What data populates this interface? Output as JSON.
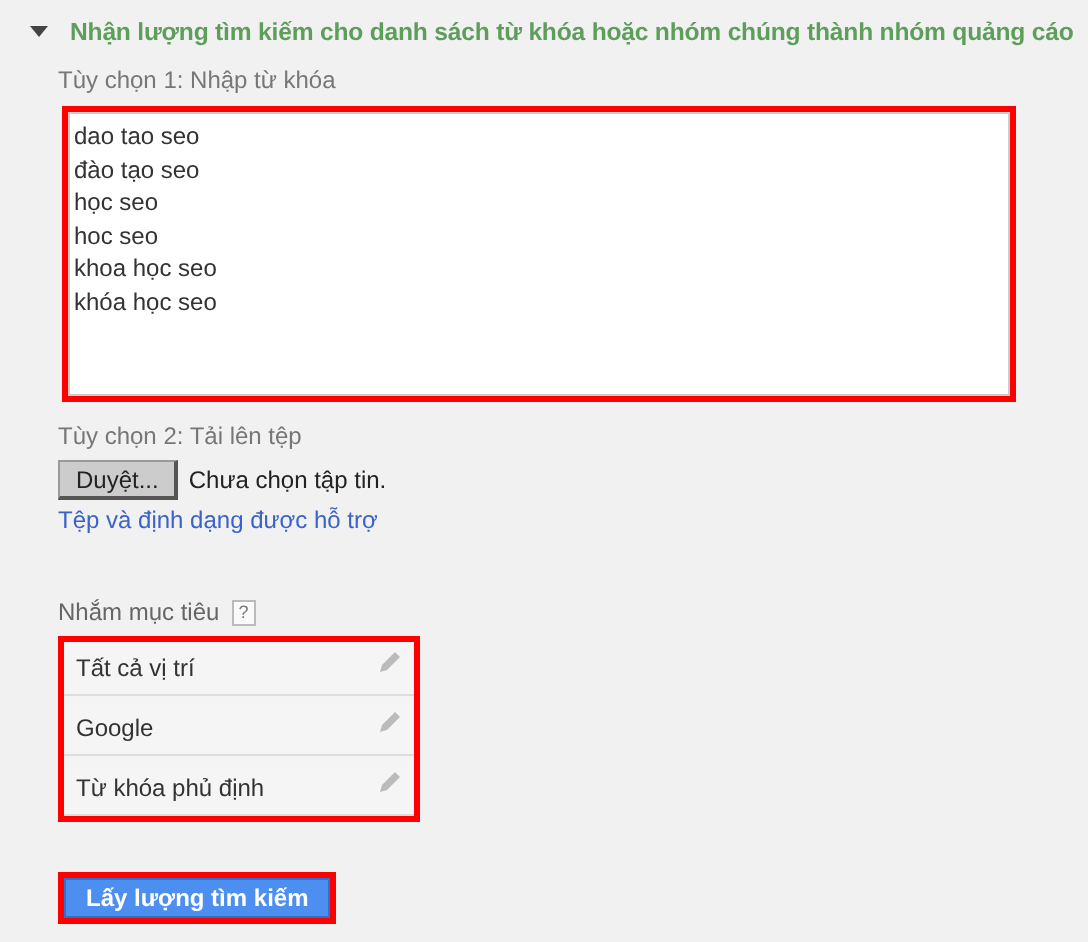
{
  "section": {
    "title": "Nhận lượng tìm kiếm cho danh sách từ khóa hoặc nhóm chúng thành nhóm quảng cáo",
    "expanded": true
  },
  "option_1": {
    "label": "Tùy chọn 1: Nhập từ khóa",
    "keywords": [
      "dao tao seo",
      "đào tạo seo",
      "học seo",
      "hoc seo",
      "khoa học seo",
      "khóa học seo"
    ]
  },
  "option_2": {
    "label": "Tùy chọn 2: Tải lên tệp",
    "browse_button": "Duyệt...",
    "file_status": "Chưa chọn tập tin.",
    "help_link": "Tệp và định dạng được hỗ trợ"
  },
  "targeting": {
    "label": "Nhắm mục tiêu",
    "help": "?",
    "items": [
      "Tất cả vị trí",
      "Google",
      "Từ khóa phủ định"
    ]
  },
  "submit_button": "Lấy lượng tìm kiếm"
}
